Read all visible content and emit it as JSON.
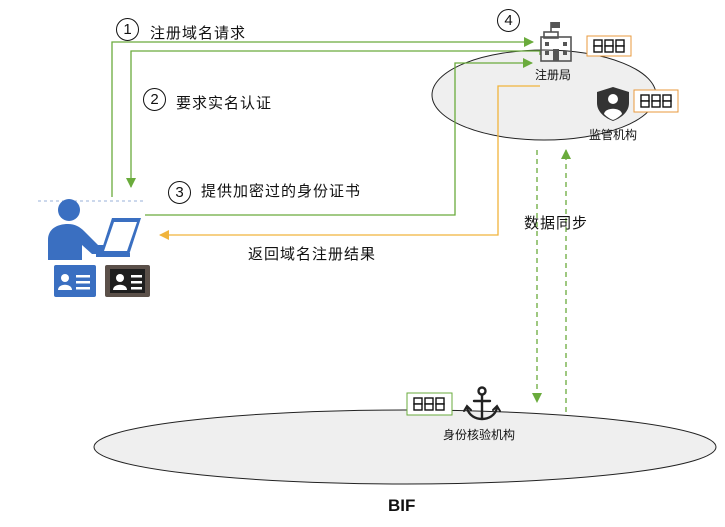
{
  "steps": [
    {
      "number": "1",
      "label": "注册域名请求"
    },
    {
      "number": "2",
      "label": "要求实名认证"
    },
    {
      "number": "3",
      "label": "提供加密过的身份证书"
    },
    {
      "number": "4",
      "label": ""
    }
  ],
  "return_label": "返回域名注册结果",
  "sync_label": "数据同步",
  "registry": {
    "label": "注册局",
    "icon": "registry-building-icon"
  },
  "regulator": {
    "label": "监管机构",
    "icon": "shield-user-icon"
  },
  "verifier": {
    "label": "身份核验机构",
    "icon": "anchor-icon"
  },
  "footer": {
    "label": "BIF"
  },
  "user": {
    "icons": [
      "user-laptop-icon",
      "id-card-blue-icon",
      "id-card-dark-icon"
    ]
  },
  "colors": {
    "green": "#6aab3c",
    "orange": "#f0b43c",
    "user_blue": "#3a6fc1",
    "ellipse_fill": "#efefef",
    "node_icon": "#555555"
  }
}
